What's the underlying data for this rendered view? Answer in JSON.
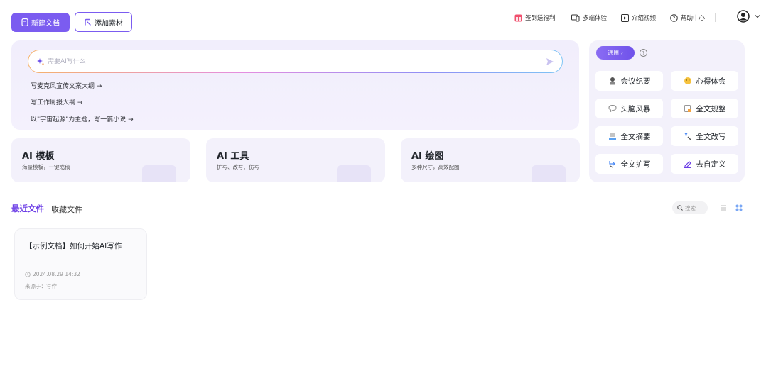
{
  "toolbar": {
    "new_doc": "新建文档",
    "add_material": "添加素材"
  },
  "topnav": {
    "signin": "签到送福利",
    "multi_device": "多端体验",
    "intro_video": "介绍视频",
    "help_center": "帮助中心"
  },
  "ai_input": {
    "placeholder": "需要AI写什么",
    "suggestions": [
      "写麦克风宣传文案大纲 →",
      "写工作周报大纲 →",
      "以\"宇宙起源\"为主题，写一篇小说 →"
    ]
  },
  "features": [
    {
      "title": "AI 模板",
      "subtitle": "海量模板，一键成稿"
    },
    {
      "title": "AI 工具",
      "subtitle": "扩写、改写、仿写"
    },
    {
      "title": "AI 绘图",
      "subtitle": "多种尺寸，高效配图"
    }
  ],
  "quick": {
    "pill": "通用 ›",
    "help": "?",
    "items": [
      "会议纪要",
      "心得体会",
      "头脑风暴",
      "全文规整",
      "全文摘要",
      "全文改写",
      "全文扩写",
      "去自定义"
    ]
  },
  "recent": {
    "tab_recent": "最近文件",
    "tab_favorites": "收藏文件",
    "search_placeholder": "搜索"
  },
  "doc": {
    "title": "【示例文档】如何开始AI写作",
    "time": "2024.08.29 14:32",
    "source": "来源于：写作"
  },
  "colors": {
    "accent": "#7b5cf0",
    "active_tab": "#6d3fe6",
    "panel_bg": "#f3f1fb"
  }
}
